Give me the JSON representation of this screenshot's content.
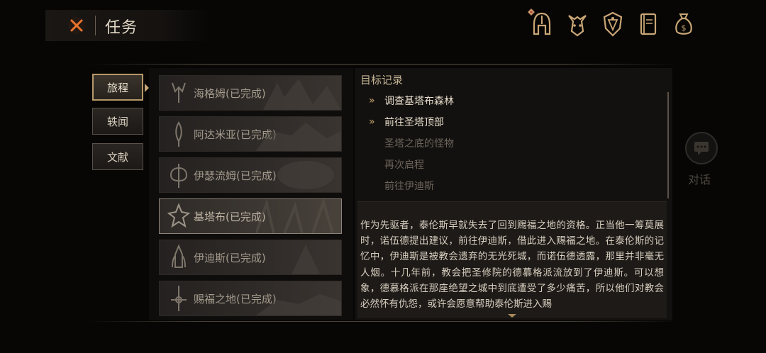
{
  "header": {
    "title": "任务"
  },
  "top_icons": [
    {
      "name": "helmet-icon",
      "has_badge": true
    },
    {
      "name": "demon-mask-icon",
      "has_badge": false
    },
    {
      "name": "shield-emblem-icon",
      "has_badge": false
    },
    {
      "name": "journal-book-icon",
      "has_badge": false
    },
    {
      "name": "coin-bag-icon",
      "has_badge": false
    }
  ],
  "tabs": [
    {
      "label": "旅程",
      "active": true
    },
    {
      "label": "轶闻",
      "active": false
    },
    {
      "label": "文献",
      "active": false
    }
  ],
  "quests": [
    {
      "name": "海格姆(已完成)",
      "icon": "horned-crest-icon",
      "selected": false
    },
    {
      "name": "阿达米亚(已完成)",
      "icon": "feather-blade-icon",
      "selected": false
    },
    {
      "name": "伊瑟流姆(已完成)",
      "icon": "battle-axe-icon",
      "selected": false
    },
    {
      "name": "基塔布(已完成)",
      "icon": "thorn-crest-icon",
      "selected": true
    },
    {
      "name": "伊迪斯(已完成)",
      "icon": "tower-spire-icon",
      "selected": false
    },
    {
      "name": "赐福之地(已完成)",
      "icon": "sword-cross-icon",
      "selected": false
    }
  ],
  "objectives": {
    "title": "目标记录",
    "items": [
      {
        "text": "调查基塔布森林",
        "state": "active"
      },
      {
        "text": "前往圣塔顶部",
        "state": "active"
      },
      {
        "text": "圣塔之底的怪物",
        "state": "done"
      },
      {
        "text": "再次启程",
        "state": "done"
      },
      {
        "text": "前往伊迪斯",
        "state": "done"
      }
    ]
  },
  "description": "作为先驱者，泰伦斯早就失去了回到赐福之地的资格。正当他一筹莫展时，诺伍德提出建议，前往伊迪斯，借此进入赐福之地。在泰伦斯的记忆中，伊迪斯是被教会遗弃的无光死城，而诺伍德透露，那里并非毫无人烟。十几年前，教会把圣修院的德慕格派流放到了伊迪斯。可以想象，德慕格派在那座绝望之城中到底遭受了多少痛苦，所以他们对教会必然怀有仇怨，或许会愿意帮助泰伦斯进入赐",
  "dialog": {
    "label": "对话"
  },
  "colors": {
    "accent_gold": "#c5a46a",
    "close_orange": "#e0662a",
    "bg": "#070605"
  }
}
